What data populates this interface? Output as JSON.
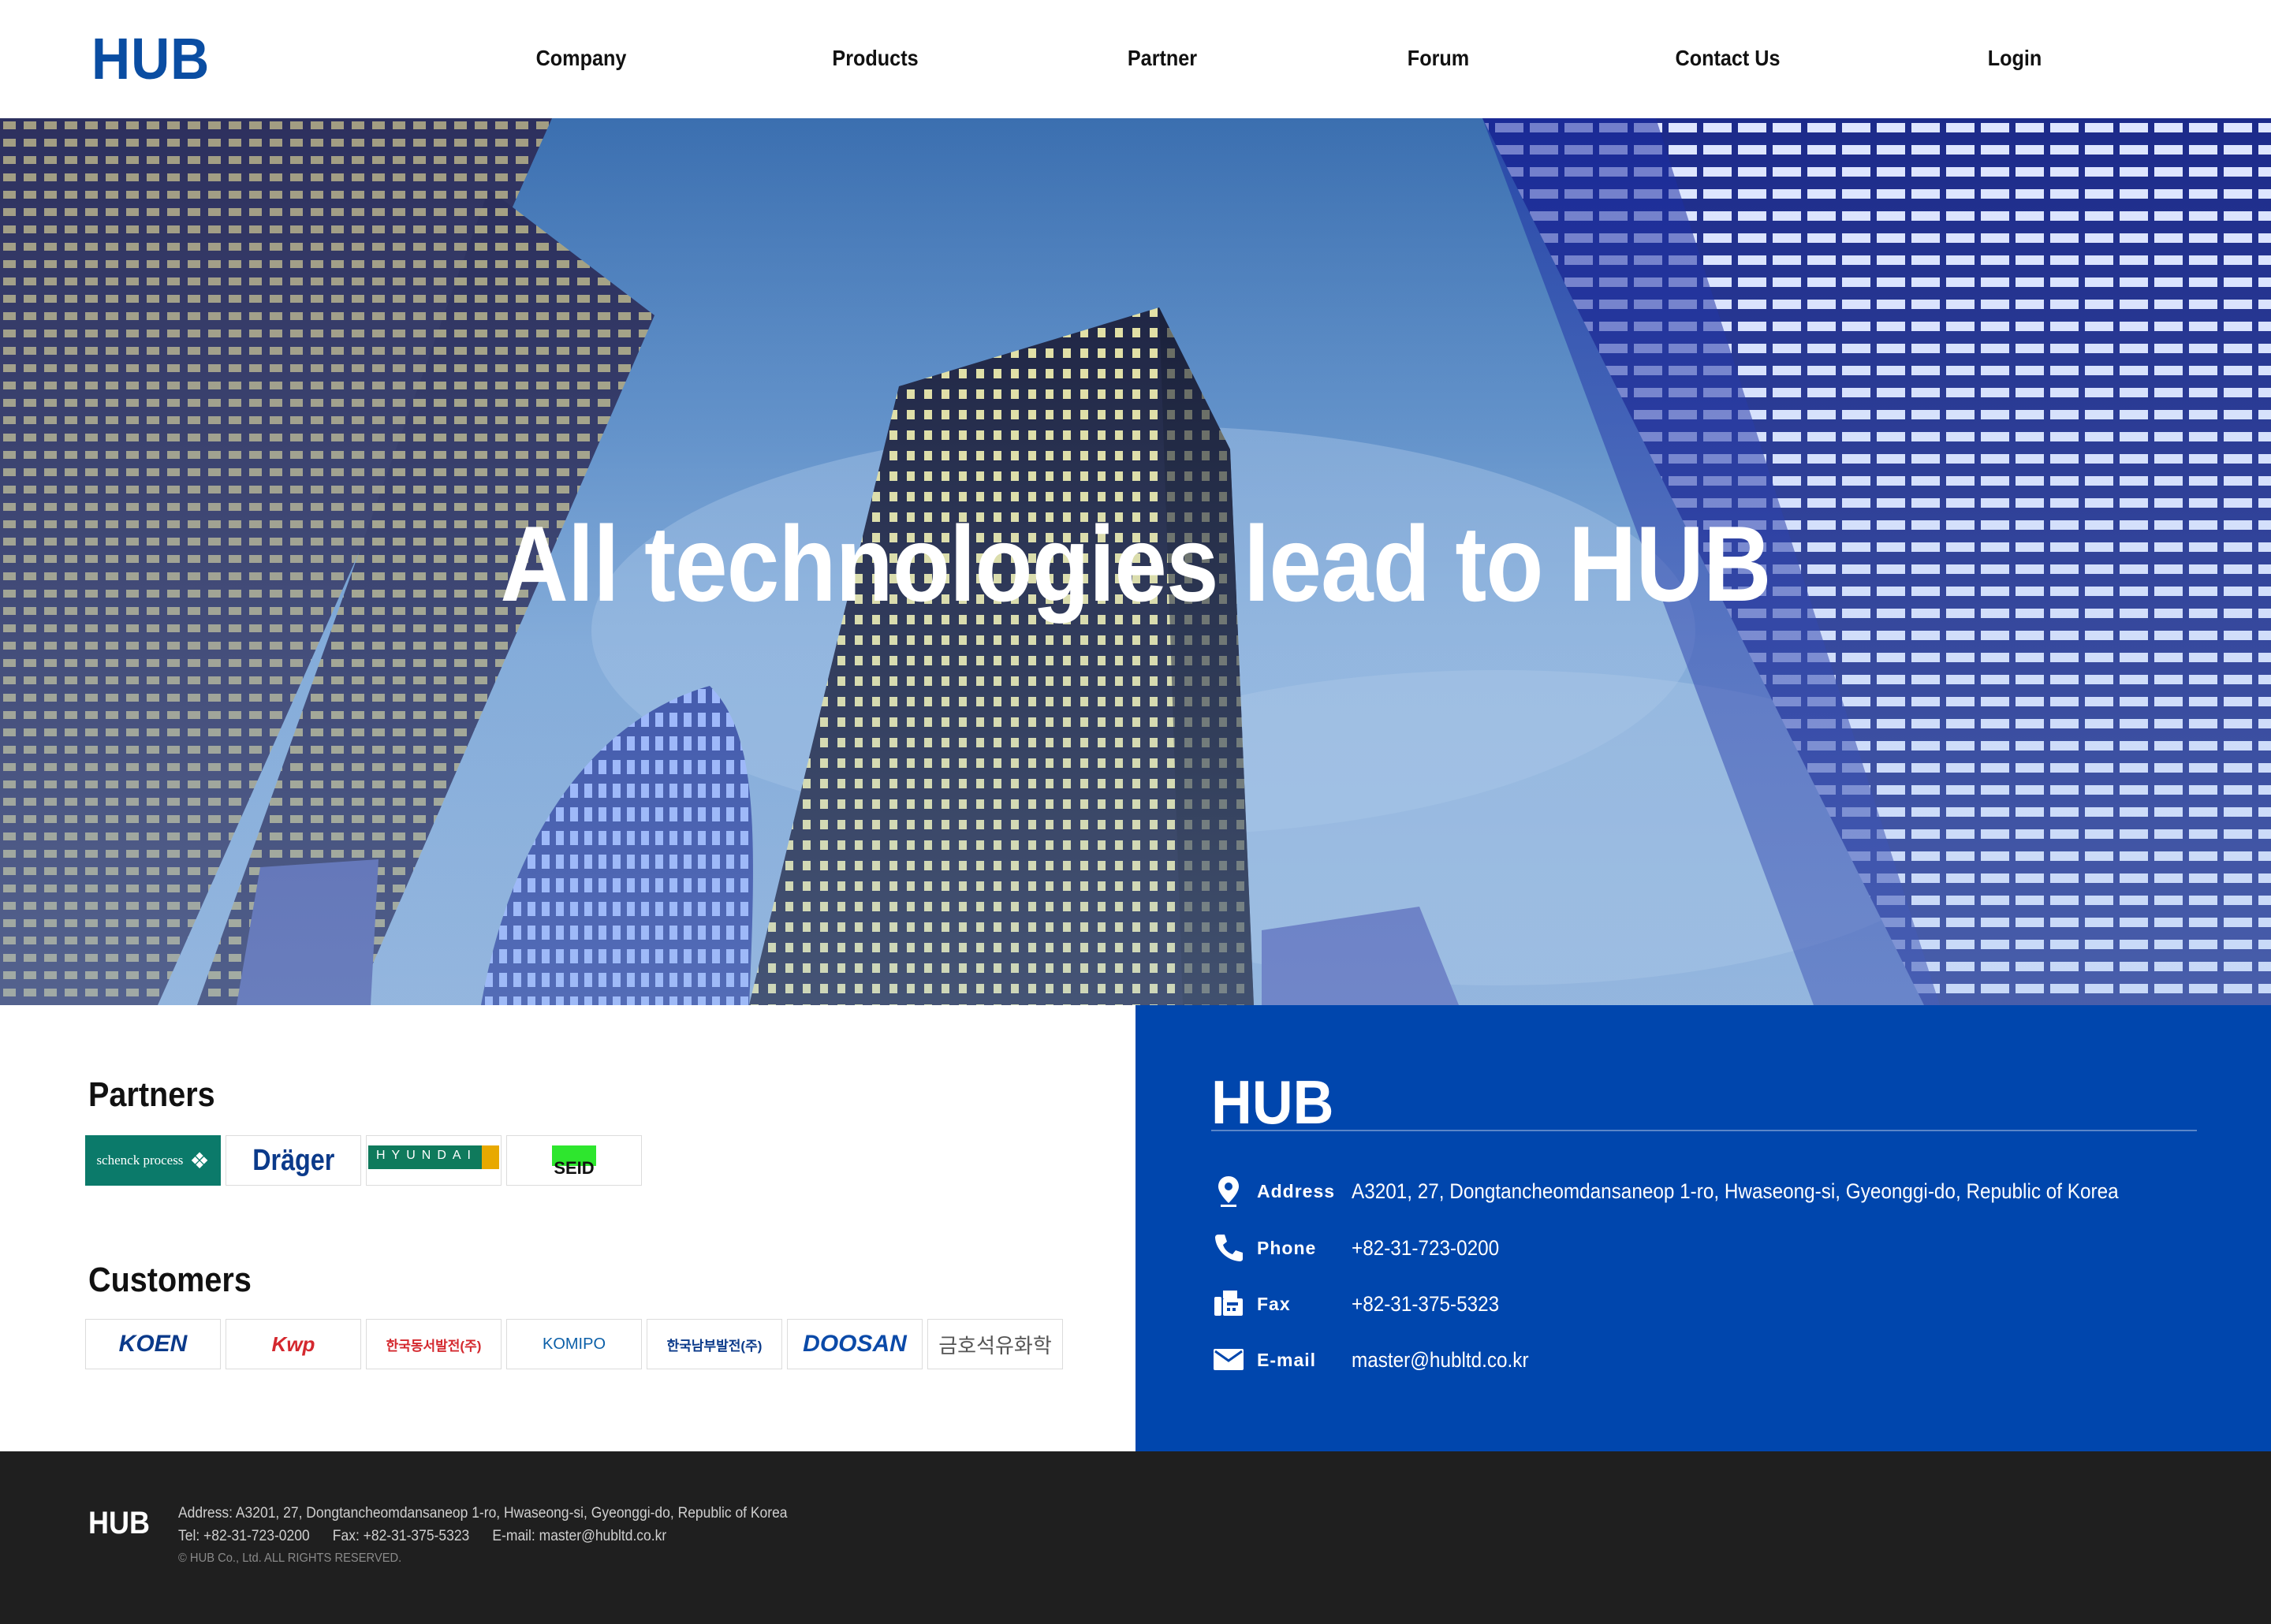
{
  "header": {
    "logo": "HUB",
    "nav": [
      "Company",
      "Products",
      "Partner",
      "Forum",
      "Contact Us",
      "Login"
    ]
  },
  "hero": {
    "title": "All technologies lead to HUB"
  },
  "partners": {
    "title": "Partners",
    "logos": [
      "schenck process",
      "Dräger",
      "HYUNDAI",
      "SEID"
    ]
  },
  "customers": {
    "title": "Customers",
    "logos": [
      "KOEN",
      "Kwp",
      "한국동서발전(주)",
      "KOMIPO",
      "한국남부발전(주)",
      "DOOSAN",
      "금호석유화학"
    ]
  },
  "contact": {
    "logo": "HUB",
    "rows": [
      {
        "icon": "location-pin-icon",
        "label": "Address",
        "value": "A3201, 27, Dongtancheomdansaneop 1-ro, Hwaseong-si, Gyeonggi-do, Republic of Korea"
      },
      {
        "icon": "phone-icon",
        "label": "Phone",
        "value": "+82-31-723-0200"
      },
      {
        "icon": "fax-icon",
        "label": "Fax",
        "value": "+82-31-375-5323"
      },
      {
        "icon": "email-icon",
        "label": "E-mail",
        "value": "master@hubltd.co.kr"
      }
    ]
  },
  "footer": {
    "logo": "HUB",
    "line1": "Address: A3201, 27, Dongtancheomdansaneop 1-ro, Hwaseong-si, Gyeonggi-do, Republic of Korea",
    "line2": "Tel: +82-31-723-0200      Fax: +82-31-375-5323      E-mail: master@hubltd.co.kr",
    "copyright": "© HUB Co., Ltd. ALL RIGHTS RESERVED."
  },
  "colors": {
    "brand_blue": "#0a4da2",
    "contact_panel": "#0046ad",
    "footer": "#1f1f1f"
  }
}
